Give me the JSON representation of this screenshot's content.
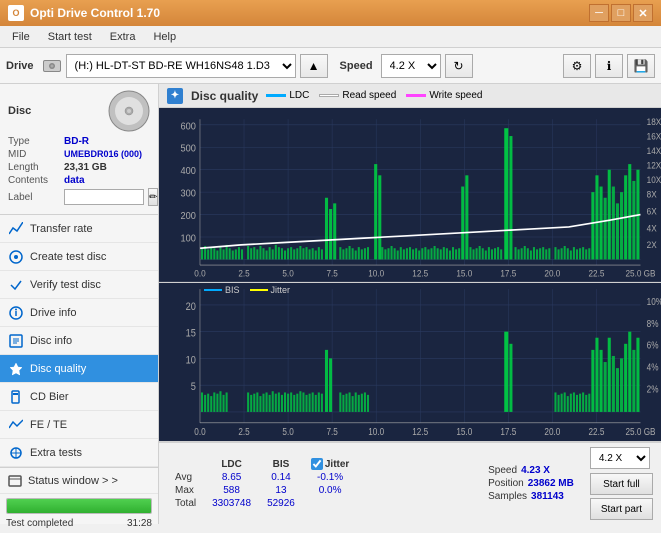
{
  "app": {
    "title": "Opti Drive Control 1.70",
    "icon": "O"
  },
  "titlebar": {
    "minimize": "─",
    "maximize": "□",
    "close": "✕"
  },
  "menubar": {
    "items": [
      "File",
      "Start test",
      "Extra",
      "Help"
    ]
  },
  "toolbar": {
    "drive_label": "Drive",
    "drive_value": "(H:)  HL-DT-ST BD-RE  WH16NS48 1.D3",
    "speed_label": "Speed",
    "speed_value": "4.2 X"
  },
  "disc": {
    "section_title": "Disc",
    "type_label": "Type",
    "type_value": "BD-R",
    "mid_label": "MID",
    "mid_value": "UMEBDR016 (000)",
    "length_label": "Length",
    "length_value": "23,31 GB",
    "contents_label": "Contents",
    "contents_value": "data",
    "label_label": "Label",
    "label_placeholder": ""
  },
  "nav": {
    "items": [
      {
        "id": "transfer-rate",
        "label": "Transfer rate",
        "icon": "📈"
      },
      {
        "id": "create-test-disc",
        "label": "Create test disc",
        "icon": "💿"
      },
      {
        "id": "verify-test-disc",
        "label": "Verify test disc",
        "icon": "✔"
      },
      {
        "id": "drive-info",
        "label": "Drive info",
        "icon": "ℹ"
      },
      {
        "id": "disc-info",
        "label": "Disc info",
        "icon": "📋"
      },
      {
        "id": "disc-quality",
        "label": "Disc quality",
        "icon": "⭐",
        "active": true
      },
      {
        "id": "cd-bier",
        "label": "CD Bier",
        "icon": "🍺"
      },
      {
        "id": "fe-te",
        "label": "FE / TE",
        "icon": "📊"
      },
      {
        "id": "extra-tests",
        "label": "Extra tests",
        "icon": "🔬"
      }
    ]
  },
  "status": {
    "window_label": "Status window > >",
    "progress": 100,
    "progress_text": "Test completed",
    "time": "31:28"
  },
  "chart": {
    "title": "Disc quality",
    "icon": "✦",
    "legend": {
      "ldc_label": "LDC",
      "ldc_color": "#00aaff",
      "read_label": "Read speed",
      "read_color": "#ffffff",
      "write_label": "Write speed",
      "write_color": "#ff44ff"
    },
    "legend2": {
      "bis_label": "BIS",
      "bis_color": "#00aaff",
      "jitter_label": "Jitter",
      "jitter_color": "#ffff00"
    },
    "yaxis1": [
      "600",
      "500",
      "400",
      "300",
      "200",
      "100"
    ],
    "yaxis1_right": [
      "18X",
      "16X",
      "14X",
      "12X",
      "10X",
      "8X",
      "6X",
      "4X",
      "2X"
    ],
    "yaxis2": [
      "20",
      "15",
      "10",
      "5"
    ],
    "yaxis2_right": [
      "10%",
      "8%",
      "6%",
      "4%",
      "2%"
    ],
    "xaxis": [
      "0.0",
      "2.5",
      "5.0",
      "7.5",
      "10.0",
      "12.5",
      "15.0",
      "17.5",
      "20.0",
      "22.5",
      "25.0 GB"
    ]
  },
  "stats": {
    "headers": [
      "LDC",
      "BIS",
      "",
      "Jitter",
      "Speed",
      ""
    ],
    "avg_label": "Avg",
    "avg_ldc": "8.65",
    "avg_bis": "0.14",
    "avg_jitter": "-0.1%",
    "max_label": "Max",
    "max_ldc": "588",
    "max_bis": "13",
    "max_jitter": "0.0%",
    "total_label": "Total",
    "total_ldc": "3303748",
    "total_bis": "52926",
    "speed_label": "Speed",
    "speed_value": "4.23 X",
    "position_label": "Position",
    "position_value": "23862 MB",
    "samples_label": "Samples",
    "samples_value": "381143",
    "speed_select": "4.2 X",
    "start_full": "Start full",
    "start_part": "Start part",
    "jitter_checked": true,
    "jitter_label": "Jitter"
  }
}
